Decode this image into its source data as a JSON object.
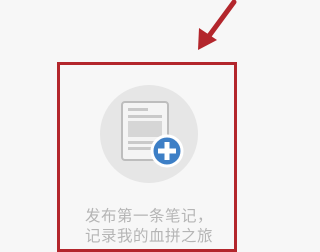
{
  "empty_state": {
    "line1": "发布第一条笔记，",
    "line2": "记录我的血拼之旅"
  },
  "colors": {
    "highlight": "#b3262c",
    "circle_bg": "#e6e6e6",
    "add_badge": "#3d7fc6",
    "muted_text": "#b5b5b5"
  },
  "icons": [
    "annotation-arrow-icon",
    "note-document-icon",
    "add-plus-icon"
  ]
}
